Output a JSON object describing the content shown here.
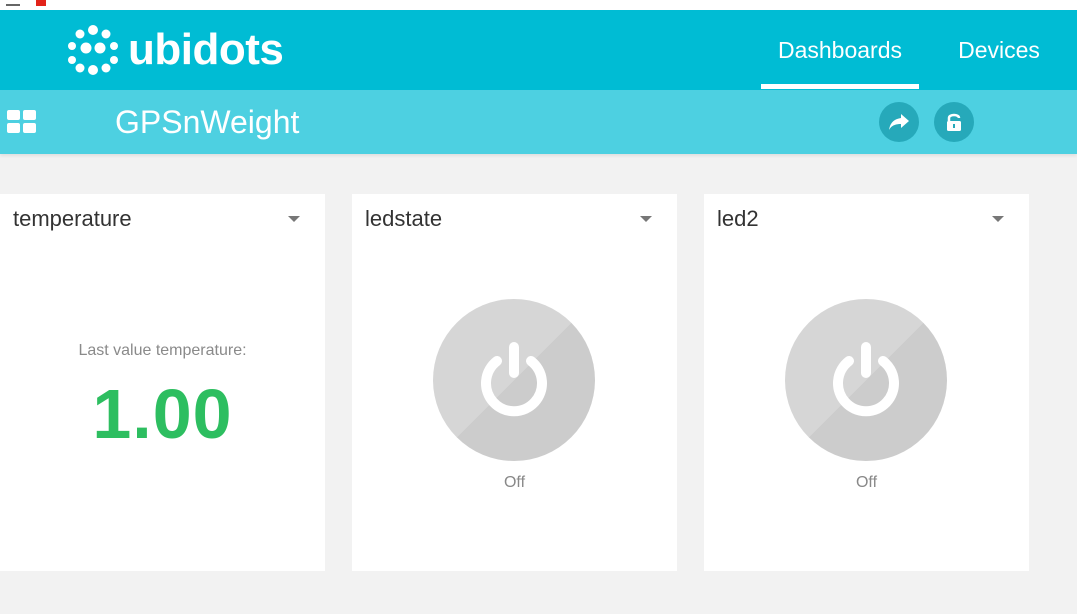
{
  "brand": {
    "name": "ubidots"
  },
  "nav": {
    "tabs": [
      {
        "label": "Dashboards",
        "active": true
      },
      {
        "label": "Devices",
        "active": false
      }
    ]
  },
  "dashboard": {
    "title": "GPSnWeight"
  },
  "colors": {
    "navbar": "#00bcd4",
    "subbar": "#4dd0e1",
    "value_green": "#2dbe60",
    "switch_off": "#d6d6d6"
  },
  "icons": {
    "grid": "grid-icon",
    "share": "share-icon",
    "lock": "lock-icon",
    "power": "power-icon",
    "caret": "caret-down-icon"
  },
  "widgets": [
    {
      "title": "temperature",
      "type": "metric",
      "caption": "Last value temperature:",
      "value": "1.00"
    },
    {
      "title": "ledstate",
      "type": "switch",
      "state": "Off"
    },
    {
      "title": "led2",
      "type": "switch",
      "state": "Off"
    }
  ]
}
